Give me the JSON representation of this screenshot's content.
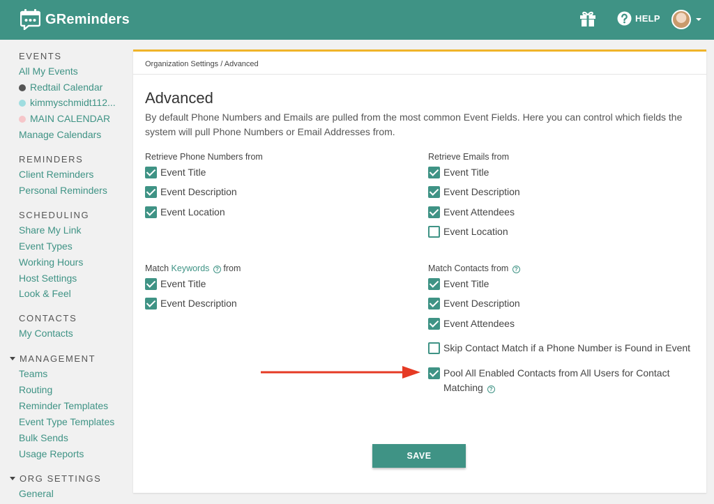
{
  "app": {
    "name": "GReminders"
  },
  "topbar": {
    "help_label": "HELP"
  },
  "colors": {
    "brand": "#3f9385",
    "accent_border": "#f0b429",
    "arrow": "#e53a24"
  },
  "sidebar": {
    "events": {
      "title": "EVENTS",
      "items": [
        "All My Events",
        "Redtail Calendar",
        "kimmyschmidt112...",
        "MAIN CALENDAR",
        "Manage Calendars"
      ],
      "dot_colors": [
        "",
        "#555555",
        "#9fdde0",
        "#f6c6c9",
        ""
      ]
    },
    "reminders": {
      "title": "REMINDERS",
      "items": [
        "Client Reminders",
        "Personal Reminders"
      ]
    },
    "scheduling": {
      "title": "SCHEDULING",
      "items": [
        "Share My Link",
        "Event Types",
        "Working Hours",
        "Host Settings",
        "Look & Feel"
      ]
    },
    "contacts": {
      "title": "CONTACTS",
      "items": [
        "My Contacts"
      ]
    },
    "management": {
      "title": "MANAGEMENT",
      "items": [
        "Teams",
        "Routing",
        "Reminder Templates",
        "Event Type Templates",
        "Bulk Sends",
        "Usage Reports"
      ]
    },
    "org_settings": {
      "title": "ORG SETTINGS",
      "items": [
        "General"
      ]
    }
  },
  "main": {
    "breadcrumb": "Organization Settings / Advanced",
    "title": "Advanced",
    "description": "By default Phone Numbers and Emails are pulled from the most common Event Fields. Here you can control which fields the system will pull Phone Numbers or Email Addresses from.",
    "phone": {
      "label": "Retrieve Phone Numbers from",
      "options": [
        {
          "label": "Event Title",
          "checked": true
        },
        {
          "label": "Event Description",
          "checked": true
        },
        {
          "label": "Event Location",
          "checked": true
        }
      ]
    },
    "emails": {
      "label": "Retrieve Emails from",
      "options": [
        {
          "label": "Event Title",
          "checked": true
        },
        {
          "label": "Event Description",
          "checked": true
        },
        {
          "label": "Event Attendees",
          "checked": true
        },
        {
          "label": "Event Location",
          "checked": false
        }
      ]
    },
    "keywords": {
      "label_prefix": "Match",
      "link": "Keywords",
      "label_suffix": "from",
      "options": [
        {
          "label": "Event Title",
          "checked": true
        },
        {
          "label": "Event Description",
          "checked": true
        }
      ]
    },
    "contacts": {
      "label": "Match Contacts from",
      "options": [
        {
          "label": "Event Title",
          "checked": true
        },
        {
          "label": "Event Description",
          "checked": true
        },
        {
          "label": "Event Attendees",
          "checked": true
        },
        {
          "label": "Skip Contact Match if a Phone Number is Found in Event",
          "checked": false
        },
        {
          "label": "Pool All Enabled Contacts from All Users for Contact Matching",
          "checked": true
        }
      ]
    },
    "save_label": "SAVE",
    "help_glyph": "?"
  }
}
